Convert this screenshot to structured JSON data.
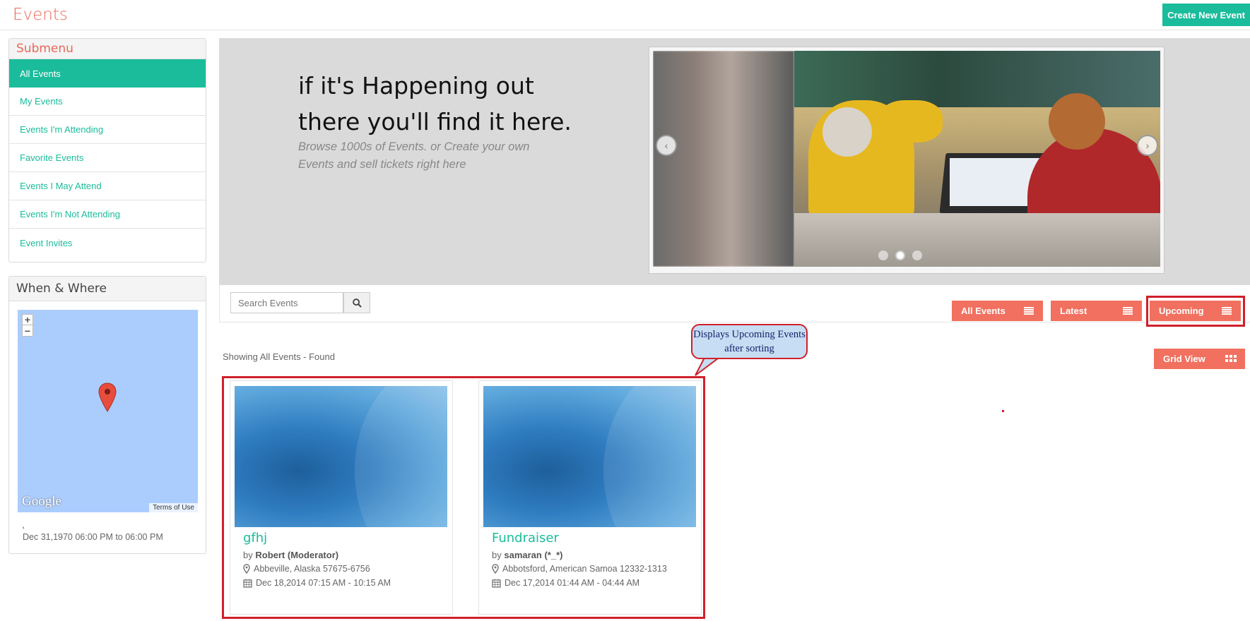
{
  "header": {
    "title": "Events",
    "create_button": "Create New Event"
  },
  "submenu": {
    "title": "Submenu",
    "items": [
      {
        "label": "All Events",
        "active": true
      },
      {
        "label": "My Events"
      },
      {
        "label": "Events I'm Attending"
      },
      {
        "label": "Favorite Events"
      },
      {
        "label": "Events I May Attend"
      },
      {
        "label": "Events I'm Not Attending"
      },
      {
        "label": "Event Invites"
      }
    ]
  },
  "when_where": {
    "title": "When & Where",
    "map": {
      "zoom_in": "+",
      "zoom_out": "−",
      "logo": "Google",
      "terms": "Terms of Use"
    },
    "location_text": ",",
    "date_text": "Dec 31,1970 06:00 PM to 06:00 PM"
  },
  "hero": {
    "title": "if it's Happening out there you'll find it here.",
    "subtitle": "Browse 1000s of Events. or Create your own Events and sell tickets right here",
    "slider_dots": 3,
    "active_dot": 2
  },
  "toolbar": {
    "search_placeholder": "Search Events",
    "sort_buttons": [
      "All Events",
      "Latest",
      "Upcoming"
    ],
    "view_button": "Grid View"
  },
  "results": {
    "showing_text": "Showing All Events - Found"
  },
  "annotation": {
    "callout_text": "Displays Upcoming Events after sorting"
  },
  "events": [
    {
      "title": "gfhj",
      "by_prefix": "by",
      "author": "Robert (Moderator)",
      "location": "Abbeville, Alaska 57675-6756",
      "date": "Dec 18,2014 07:15 AM - 10:15 AM"
    },
    {
      "title": "Fundraiser",
      "by_prefix": "by",
      "author": "samaran (*_*)",
      "location": "Abbotsford, American Samoa 12332-1313",
      "date": "Dec 17,2014 01:44 AM - 04:44 AM"
    }
  ],
  "colors": {
    "accent_teal": "#1bbc9b",
    "accent_coral": "#f1705f",
    "title_red": "#e8685a",
    "highlight_red": "#d0202a"
  }
}
